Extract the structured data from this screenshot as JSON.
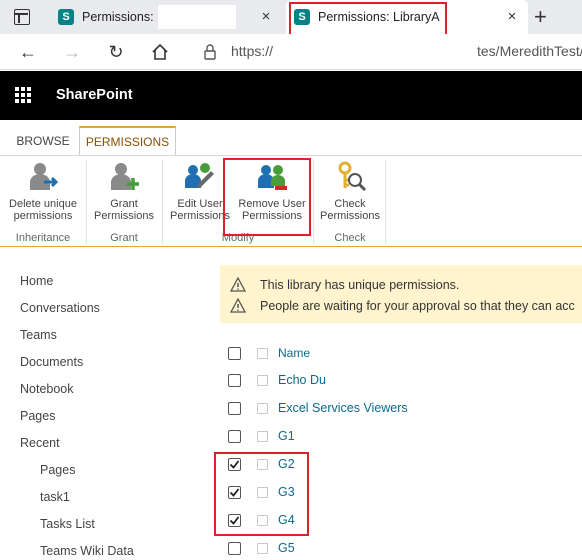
{
  "browser": {
    "tabs": [
      {
        "title": "Permissions:",
        "close": "×"
      },
      {
        "title": "Permissions: LibraryA",
        "close": "×"
      }
    ],
    "new_tab": "+",
    "url": "https://",
    "url_tail": "tes/MeredithTest/"
  },
  "suite": {
    "brand": "SharePoint"
  },
  "ribbon": {
    "tabs": [
      "BROWSE",
      "PERMISSIONS"
    ],
    "buttons": [
      {
        "label1": "Delete unique",
        "label2": "permissions"
      },
      {
        "label1": "Grant",
        "label2": "Permissions"
      },
      {
        "label1": "Edit User",
        "label2": "Permissions"
      },
      {
        "label1": "Remove User",
        "label2": "Permissions"
      },
      {
        "label1": "Check",
        "label2": "Permissions"
      }
    ],
    "groups": [
      "Inheritance",
      "Grant",
      "Modify",
      "Check"
    ]
  },
  "leftnav": {
    "items": [
      "Home",
      "Conversations",
      "Teams",
      "Documents",
      "Notebook",
      "Pages",
      "Recent"
    ],
    "recent": [
      "Pages",
      "task1",
      "Tasks List",
      "Teams Wiki Data"
    ]
  },
  "banner": {
    "line1": "This library has unique permissions.",
    "line2": "People are waiting for your approval so that they can acc"
  },
  "list": {
    "header": "Name",
    "rows": [
      {
        "name": "Echo Du",
        "checked": false
      },
      {
        "name": "Excel Services Viewers",
        "checked": false
      },
      {
        "name": "G1",
        "checked": false
      },
      {
        "name": "G2",
        "checked": true
      },
      {
        "name": "G3",
        "checked": true
      },
      {
        "name": "G4",
        "checked": true
      },
      {
        "name": "G5",
        "checked": false
      }
    ]
  },
  "colors": {
    "accent": "#e8a13a",
    "highlight": "#d9232a",
    "link": "#0b6a8f",
    "brand": "#038387"
  }
}
